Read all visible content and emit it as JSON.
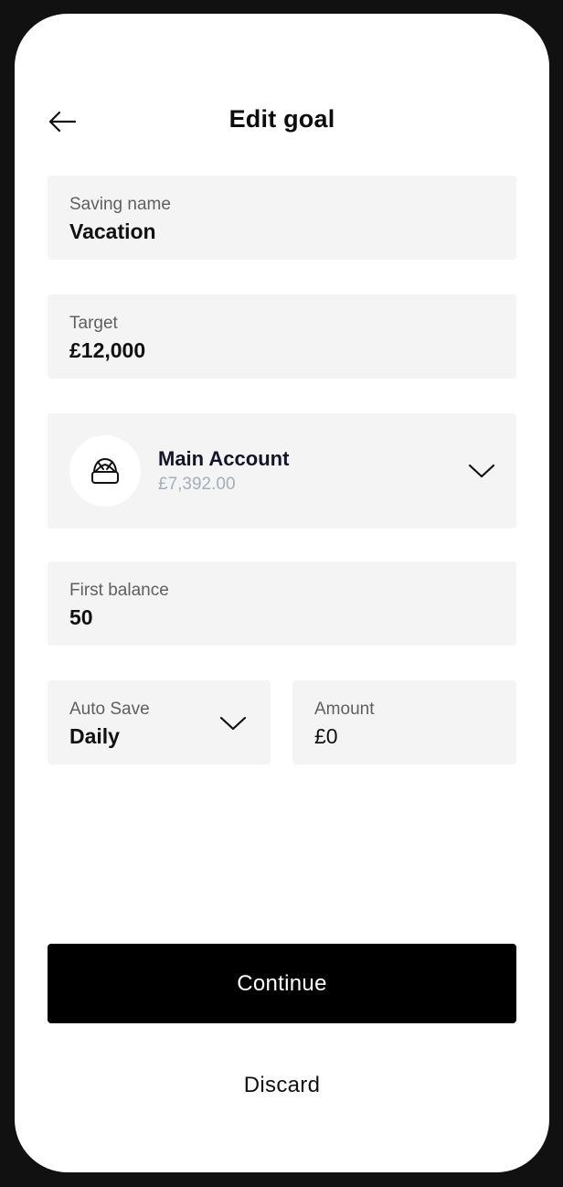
{
  "header": {
    "title": "Edit goal",
    "back_icon": "arrow-left-icon"
  },
  "fields": {
    "saving_name": {
      "label": "Saving name",
      "value": "Vacation"
    },
    "target": {
      "label": "Target",
      "value": "£12,000"
    },
    "first_balance": {
      "label": "First balance",
      "value": "50"
    }
  },
  "account": {
    "icon": "wallet-icon",
    "name": "Main Account",
    "balance": "£7,392.00",
    "dropdown_icon": "chevron-down-icon"
  },
  "auto_save": {
    "label": "Auto Save",
    "value": "Daily",
    "dropdown_icon": "chevron-down-icon"
  },
  "amount": {
    "label": "Amount",
    "value": "£0"
  },
  "actions": {
    "continue_label": "Continue",
    "discard_label": "Discard"
  },
  "colors": {
    "primary_button": "#000000",
    "field_background": "#f4f4f4",
    "account_name": "#14142b",
    "muted_balance": "#a6adba"
  }
}
